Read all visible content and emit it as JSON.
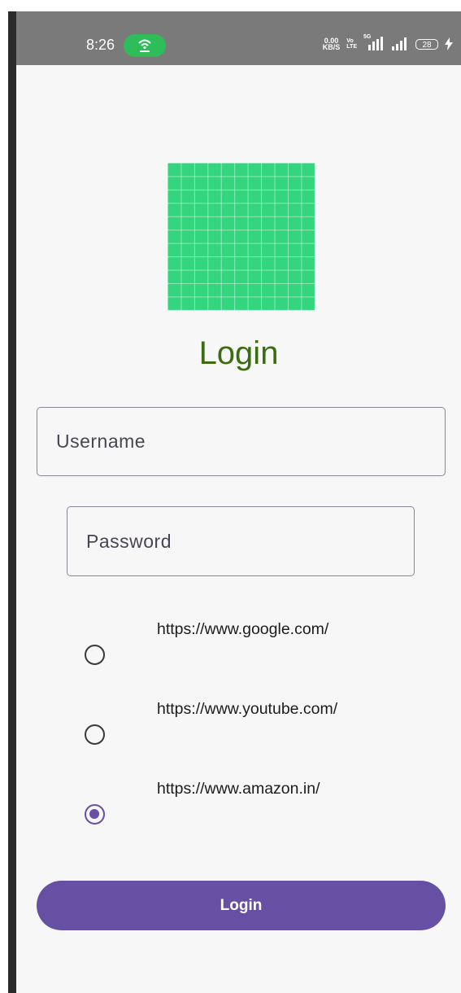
{
  "status_bar": {
    "time": "8:26",
    "net_speed_value": "0.00",
    "net_speed_unit": "KB/S",
    "volte_top": "Vo",
    "volte_bottom": "LTE",
    "network_type": "5G",
    "battery_level": "28"
  },
  "header": {
    "title": "Login"
  },
  "form": {
    "username_placeholder": "Username",
    "password_placeholder": "Password"
  },
  "site_options": {
    "selected_index": 2,
    "items": [
      {
        "label": "https://www.google.com/",
        "checked": false
      },
      {
        "label": "https://www.youtube.com/",
        "checked": false
      },
      {
        "label": "https://www.amazon.in/",
        "checked": true
      }
    ]
  },
  "actions": {
    "login_label": "Login"
  },
  "colors": {
    "status_bar": "#7a7a7a",
    "hotspot_pill": "#2ebd59",
    "logo": "#33d67e",
    "title": "#3b6d10",
    "accent": "#6650a4"
  },
  "icons": {
    "hotspot": "hotspot-icon",
    "signal": "signal-icon",
    "battery": "battery-icon",
    "charging": "charging-bolt-icon"
  }
}
